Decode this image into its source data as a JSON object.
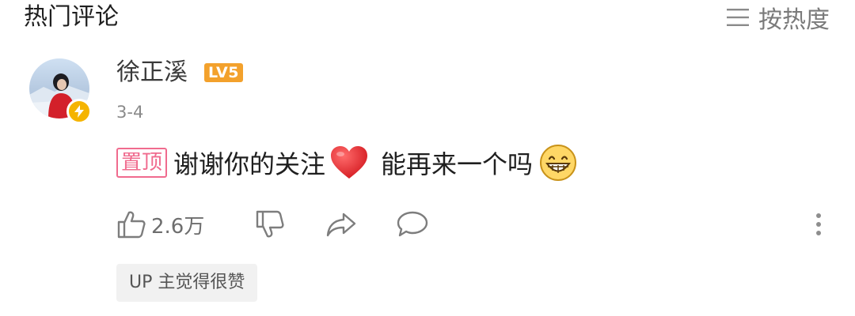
{
  "header": {
    "title": "热门评论",
    "sort_icon": "menu-lines-icon",
    "sort_label": "按热度"
  },
  "comment": {
    "username": "徐正溪",
    "level": "LV5",
    "date": "3-4",
    "pinned_tag": "置顶",
    "text_part1": "谢谢你的关注",
    "emoji1": "red-heart",
    "text_part2": "能再来一个吗",
    "emoji2": "grinning-face",
    "like_count": "2.6万",
    "up_badge": "UP 主觉得很赞"
  },
  "icons": {
    "like": "thumbs-up-icon",
    "dislike": "thumbs-down-icon",
    "share": "share-arrow-icon",
    "reply": "speech-bubble-icon",
    "more": "vertical-dots-icon"
  },
  "colors": {
    "level_badge": "#f3a12c",
    "pinned_tag": "#f06b8e",
    "avatar_badge": "#f5b400"
  }
}
